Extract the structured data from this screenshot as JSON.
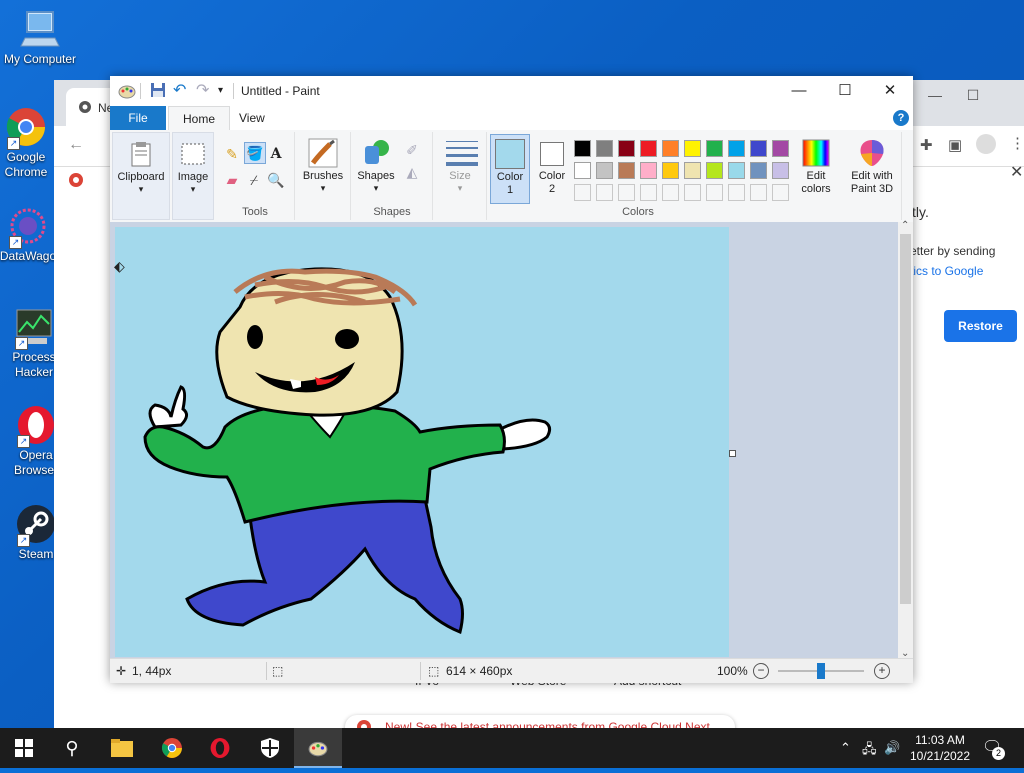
{
  "desktop": {
    "icons": [
      {
        "label": "My Computer"
      },
      {
        "label": "Google Chrome"
      },
      {
        "label": "DataWago"
      },
      {
        "label": "Process Hacker"
      },
      {
        "label": "Opera Browser"
      },
      {
        "label": "Steam"
      }
    ]
  },
  "chrome": {
    "tab_title": "Ne",
    "content_text_1": "tly.",
    "content_text_2": "etter by sending",
    "content_text_3": "tics to Google",
    "restore_label": "Restore",
    "bottom_notice": "New! See the latest announcements from Google Cloud Next",
    "faded_labels": [
      "If Vo",
      "Web Store",
      "Add shortcut"
    ]
  },
  "paint": {
    "title": "Untitled - Paint",
    "tabs": {
      "file": "File",
      "home": "Home",
      "view": "View"
    },
    "help": "?",
    "ribbon": {
      "clipboard": "Clipboard",
      "image": "Image",
      "tools_group": "Tools",
      "brushes": "Brushes",
      "shapes": "Shapes",
      "shapes_group": "Shapes",
      "size": "Size",
      "color1": "Color 1",
      "color2": "Color 2",
      "colors_group": "Colors",
      "edit_colors": "Edit colors",
      "edit_paint3d": "Edit with Paint 3D"
    },
    "palette_row1": [
      "#000000",
      "#7f7f7f",
      "#880015",
      "#ed1c24",
      "#ff7f27",
      "#fff200",
      "#22b14c",
      "#00a2e8",
      "#3f48cc",
      "#a349a4"
    ],
    "palette_row2": [
      "#ffffff",
      "#c3c3c3",
      "#b97a57",
      "#ffaec9",
      "#ffc90e",
      "#efe4b0",
      "#b5e61d",
      "#99d9ea",
      "#7092be",
      "#c8bfe7"
    ],
    "color1_value": "#a3d9ec",
    "color2_value": "#ffffff",
    "status": {
      "cursor_pos": "1, 44px",
      "canvas_size": "614 × 460px",
      "zoom": "100%",
      "zoom_fraction": 0.5
    }
  },
  "taskbar": {
    "time": "11:03 AM",
    "date": "10/21/2022",
    "notifications": "2"
  }
}
